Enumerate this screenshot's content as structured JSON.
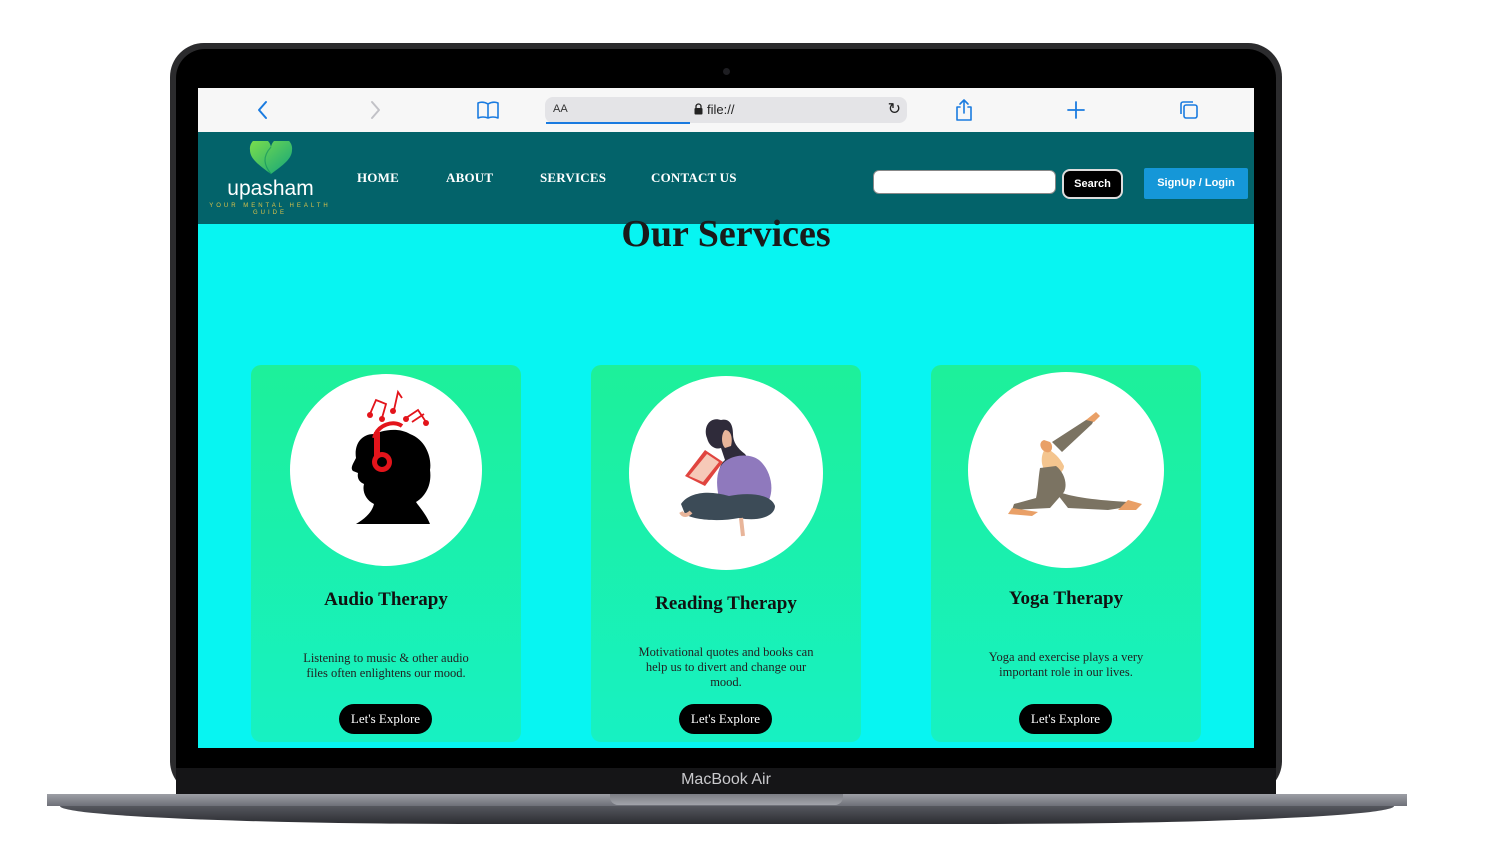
{
  "device": {
    "label": "MacBook Air"
  },
  "browser": {
    "text_size_label": "AA",
    "url": "file://",
    "icons": [
      "back-icon",
      "forward-icon",
      "bookmarks-icon",
      "lock-icon",
      "reload-icon",
      "share-icon",
      "new-tab-icon",
      "tabs-icon"
    ]
  },
  "site": {
    "logo": {
      "name": "upasham",
      "tagline": "YOUR MENTAL HEALTH GUIDE"
    },
    "nav": [
      "HOME",
      "ABOUT",
      "SERVICES",
      "CONTACT US"
    ],
    "search": {
      "value": "",
      "button": "Search"
    },
    "auth_button": "SignUp / Login",
    "colors": {
      "navbar": "#03636a",
      "page_bg": "#07f5f2",
      "card": "#1df09a",
      "auth_button": "#1597d8"
    }
  },
  "main": {
    "title": "Our Services",
    "cards": [
      {
        "title": "Audio Therapy",
        "description": "Listening to music & other audio files often enlightens our mood.",
        "button": "Let's Explore",
        "icon": "headphones-silhouette-image"
      },
      {
        "title": "Reading Therapy",
        "description": "Motivational quotes and books can help us to divert and change our mood.",
        "button": "Let's Explore",
        "icon": "reading-woman-image"
      },
      {
        "title": "Yoga Therapy",
        "description": "Yoga and exercise plays a very important role in our lives.",
        "button": "Let's Explore",
        "icon": "yoga-pose-image"
      }
    ]
  }
}
